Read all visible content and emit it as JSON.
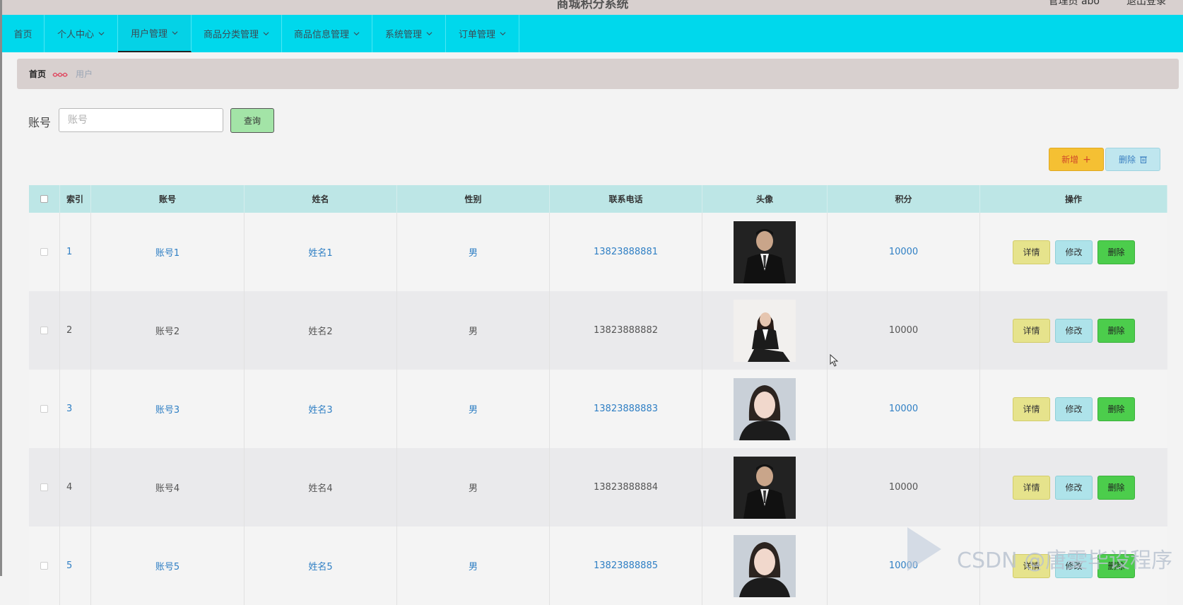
{
  "header": {
    "title": "商城积分系统",
    "user": "管理员 abo",
    "logout": "退出登录"
  },
  "nav": [
    {
      "label": "首页",
      "dropdown": false,
      "width": 60
    },
    {
      "label": "个人中心",
      "dropdown": true,
      "width": 104
    },
    {
      "label": "用户管理",
      "dropdown": true,
      "width": 104,
      "active": true
    },
    {
      "label": "商品分类管理",
      "dropdown": true,
      "width": 128
    },
    {
      "label": "商品信息管理",
      "dropdown": true,
      "width": 128
    },
    {
      "label": "系统管理",
      "dropdown": true,
      "width": 104
    },
    {
      "label": "订单管理",
      "dropdown": true,
      "width": 104
    }
  ],
  "breadcrumb": {
    "home": "首页",
    "current": "用户"
  },
  "search": {
    "label": "账号",
    "placeholder": "账号",
    "button": "查询"
  },
  "actions": {
    "add": "新增",
    "delete": "删除"
  },
  "table": {
    "headers": [
      "索引",
      "账号",
      "姓名",
      "性别",
      "联系电话",
      "头像",
      "积分",
      "操作"
    ],
    "rows": [
      {
        "index": "1",
        "account": "账号1",
        "name": "姓名1",
        "gender": "男",
        "phone": "13823888881",
        "points": "10000",
        "avatar": "man-suit-icon"
      },
      {
        "index": "2",
        "account": "账号2",
        "name": "姓名2",
        "gender": "男",
        "phone": "13823888882",
        "points": "10000",
        "avatar": "woman-suit-icon"
      },
      {
        "index": "3",
        "account": "账号3",
        "name": "姓名3",
        "gender": "男",
        "phone": "13823888883",
        "points": "10000",
        "avatar": "woman-portrait-icon"
      },
      {
        "index": "4",
        "account": "账号4",
        "name": "姓名4",
        "gender": "男",
        "phone": "13823888884",
        "points": "10000",
        "avatar": "man-suit-icon"
      },
      {
        "index": "5",
        "account": "账号5",
        "name": "姓名5",
        "gender": "男",
        "phone": "13823888885",
        "points": "10000",
        "avatar": "woman-portrait-icon"
      }
    ],
    "ops": {
      "detail": "详情",
      "edit": "修改",
      "delete": "删除"
    }
  },
  "watermark": "CSDN @唐雯毕设程序",
  "colors": {
    "nav": "#00d8ec",
    "breadcrumb": "#d8d0cf",
    "tableHeader": "#bde6e6",
    "link": "#2f7fc4",
    "add": "#f5c033",
    "delete": "#4ccd4c"
  }
}
